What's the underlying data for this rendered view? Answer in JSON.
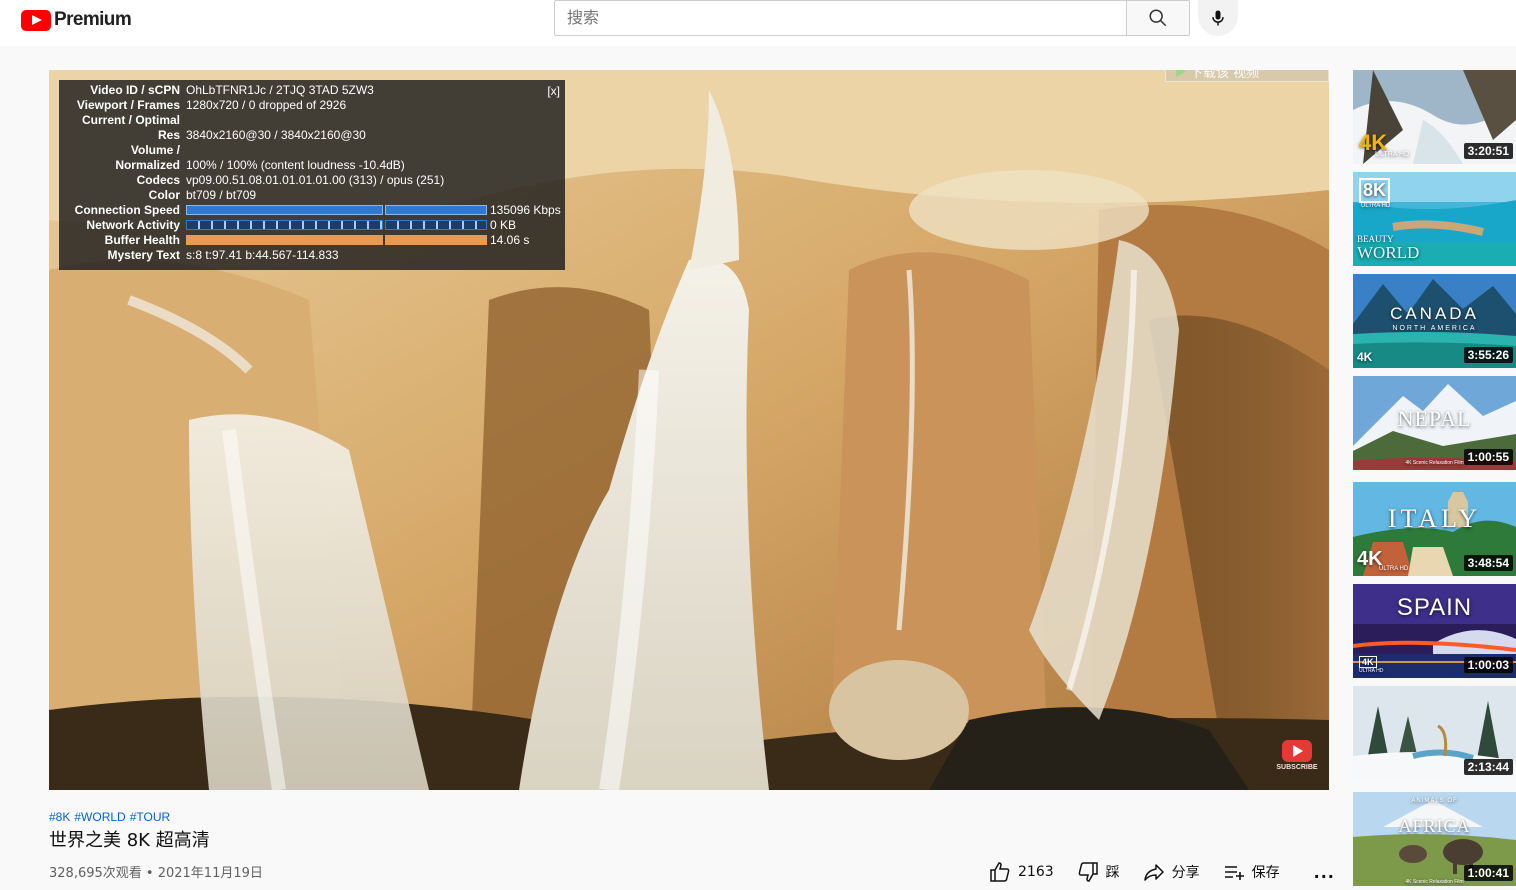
{
  "header": {
    "logo_text": "Premium",
    "search_placeholder": "搜索"
  },
  "player": {
    "stats": {
      "close_label": "[x]",
      "rows": [
        {
          "label": "Video ID / sCPN",
          "value": "OhLbTFNR1Jc / 2TJQ 3TAD 5ZW3"
        },
        {
          "label": "Viewport / Frames",
          "value": "1280x720 / 0 dropped of 2926"
        },
        {
          "label": "Current / Optimal",
          "value": ""
        },
        {
          "label": "Res",
          "value": "3840x2160@30 / 3840x2160@30"
        },
        {
          "label": "Volume /",
          "value": ""
        },
        {
          "label": "Normalized",
          "value": "100% / 100% (content loudness -10.4dB)"
        },
        {
          "label": "Codecs",
          "value": "vp09.00.51.08.01.01.01.01.00 (313) / opus (251)"
        },
        {
          "label": "Color",
          "value": "bt709 / bt709"
        },
        {
          "label": "Connection Speed",
          "value": "135096 Kbps"
        },
        {
          "label": "Network Activity",
          "value": "0 KB"
        },
        {
          "label": "Buffer Health",
          "value": "14.06 s"
        },
        {
          "label": "Mystery Text",
          "value": "s:8 t:97.41 b:44.567-114.833"
        }
      ]
    },
    "download_widget_text": "下载该 视频",
    "watermark_text": "SUBSCRIBE"
  },
  "video": {
    "hashtags": [
      "#8K",
      "#WORLD",
      "#TOUR"
    ],
    "title": "世界之美 8K 超高清",
    "views": "328,695次观看",
    "separator": "•",
    "date": "2021年11月19日",
    "like_count": "2163",
    "dislike_label": "踩",
    "share_label": "分享",
    "save_label": "保存",
    "more_label": "..."
  },
  "sidebar": {
    "items": [
      {
        "duration": "3:20:51",
        "badge": "4K",
        "badge_sub": "ULTRA HD"
      },
      {
        "duration": "",
        "badge": "8K",
        "badge_sub": "ULTRA HD",
        "overlay": "BEAUTY",
        "overlay2": "WORLD"
      },
      {
        "duration": "3:55:26",
        "badge": "4K",
        "overlay": "CANADA",
        "overlay2": "NORTH AMERICA"
      },
      {
        "duration": "1:00:55",
        "overlay": "NEPAL",
        "overlay2": "4K Scenic Relaxation Film"
      },
      {
        "duration": "3:48:54",
        "badge": "4K",
        "badge_sub": "ULTRA HD",
        "overlay": "ITALY"
      },
      {
        "duration": "1:00:03",
        "badge": "4K",
        "badge_sub": "ULTRA HD",
        "overlay": "SPAIN"
      },
      {
        "duration": "2:13:44"
      },
      {
        "duration": "1:00:41",
        "overlay": "AFRICA",
        "overlay2": "ANIMALS OF",
        "overlay3": "4K Scenic Relaxation Film"
      }
    ]
  },
  "colors": {
    "brand_red": "#ff0000",
    "link_blue": "#065fd4",
    "stats_bar_blue": "#2f7ad0",
    "stats_bar_orange": "#e89a53"
  }
}
